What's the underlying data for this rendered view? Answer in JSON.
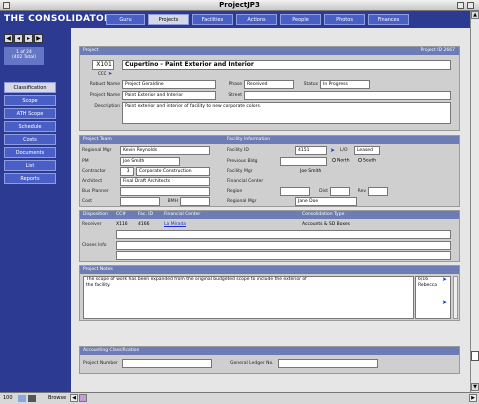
{
  "window": {
    "title": "ProjectJP3"
  },
  "app": {
    "name": "THE CONSOLIDATOR"
  },
  "nav_tabs": [
    "Guru",
    "Projects",
    "Facilities",
    "Actions",
    "People",
    "Photos",
    "Finances"
  ],
  "records": {
    "line1": "1 of 24",
    "line2": "(402 Total)"
  },
  "sidebar": [
    "Classification",
    "Scope",
    "ATH Scope",
    "Schedule",
    "Costs",
    "Documents",
    "List",
    "Reports"
  ],
  "project": {
    "header": "Project",
    "id_label": "Project ID 2667",
    "number": "X101",
    "sub": "CCC",
    "title": "Cupertino - Paint Exterior and Interior",
    "robust_name_label": "Robust Name",
    "robust_name": "Project Geraldine",
    "phase_label": "Phase",
    "phase": "Received",
    "status_label": "Status",
    "status": "In Progress",
    "project_name_label": "Project Name",
    "project_name": "Paint Exterior and Interior",
    "street_label": "Street",
    "street": "",
    "description_label": "Description",
    "description": "Paint exterior and interior of facility to new corporate colors."
  },
  "team": {
    "header": "Project Team",
    "regional_mgr_label": "Regional Mgr",
    "regional_mgr": "Kevin Reynolds",
    "pm_label": "PM",
    "pm": "Joe Smith",
    "contractor_label": "Contractor",
    "contractor_code": "3",
    "contractor": "Corporate Construction",
    "architect_label": "Architect",
    "architect": "Final Draft Architects",
    "bus_planner_label": "Bus Planner",
    "bus_planner": "",
    "cost_label": "Cost",
    "cost": "",
    "bmh_label": "BMH",
    "bmh": ""
  },
  "facility": {
    "header": "Facility Information",
    "facility_id_label": "Facility ID",
    "facility_id": "4151",
    "lo_label": "L/O",
    "leased_label": "Leased",
    "previous_bldg_label": "Previous Bldg",
    "north_label": "North",
    "south_label": "South",
    "facility_mgr_label": "Facility Mgr",
    "facility_mgr": "Joe Smith",
    "financial_center_label": "Financial Center",
    "region_label": "Region",
    "region": "",
    "dist_label": "Dist",
    "rev_label": "Rev",
    "regional_mgr_label": "Regional Mgr",
    "regional_mgr": "Jane Doe"
  },
  "disposition": {
    "header": "Disposition",
    "cc_label": "CC#",
    "fac_label": "Fac. ID",
    "fincenter_label": "Financial Center",
    "consolidation_label": "Consolidation Type",
    "receiver_label": "Receiver",
    "cc": "X116",
    "fac": "4166",
    "fincenter": "La Mirada",
    "consolidation": "Accounts & SD Boxes",
    "closes_info_label": "Closes Info"
  },
  "notes": {
    "header": "Project Notes",
    "text1": "The scope of work has been expanded from the original budgeted scope to include the exterior of",
    "text2": "the facility.",
    "date": "6/16",
    "author": "Rebecca"
  },
  "accounting": {
    "header": "Accounting Classification",
    "project_number_label": "Project Number",
    "project_number": "",
    "gl_label": "General Ledger No.",
    "gl": ""
  },
  "status_bar": {
    "zoom": "100",
    "mode": "Browse"
  },
  "colors": {
    "header_blue": "#2c3a92",
    "button_blue": "#4a5fc6",
    "panel_header": "#6d7cb4",
    "link": "#1a2fd0"
  }
}
